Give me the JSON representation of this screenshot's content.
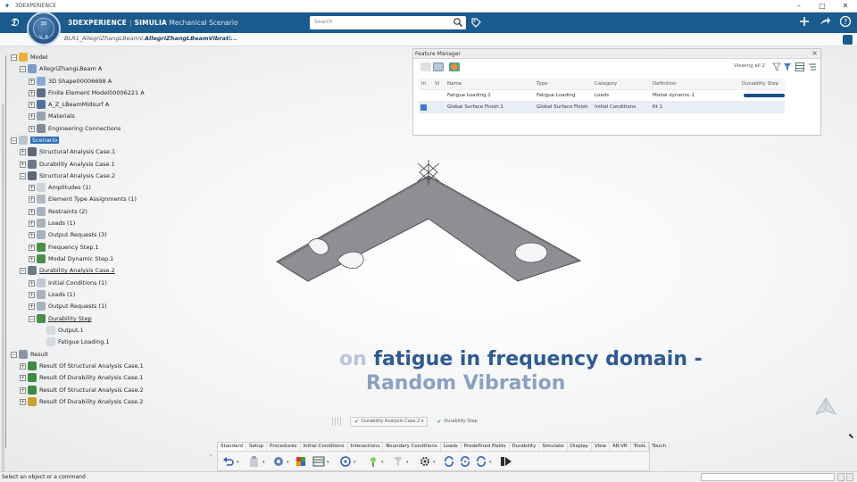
{
  "os_title": "3DEXPERIENCE",
  "window_controls": [
    "–",
    "□",
    "✕"
  ],
  "app": {
    "brand_3d": "3DEXPERIENCE",
    "sep": "|",
    "brand_simulia": "SIMULIA",
    "app_name": "Mechanical Scenario",
    "search_placeholder": "Search",
    "compass_top": "3D",
    "compass_bottom": "V, R"
  },
  "tabs": [
    {
      "label": "BLR1_AllegriZhangLBeamV..."
    },
    {
      "label": "AllegriZhangLBeamVibrati..."
    },
    {
      "label": "+"
    }
  ],
  "tree": {
    "nodes": [
      {
        "label": "Model"
      },
      {
        "label": "AllegriZhangLBeam A"
      },
      {
        "label": "3D Shape00006698 A"
      },
      {
        "label": "Finite Element Model00006221 A"
      },
      {
        "label": "A_Z_LBeamMidsurf A"
      },
      {
        "label": "Materials"
      },
      {
        "label": "Engineering Connections"
      },
      {
        "label": "Scenario"
      },
      {
        "label": "Structural Analysis Case.1"
      },
      {
        "label": "Durability Analysis Case.1"
      },
      {
        "label": "Structural Analysis Case.2"
      },
      {
        "label": "Amplitudes (1)"
      },
      {
        "label": "Element Type Assignments (1)"
      },
      {
        "label": "Restraints (2)"
      },
      {
        "label": "Loads (1)"
      },
      {
        "label": "Output Requests (3)"
      },
      {
        "label": "Frequency Step.1"
      },
      {
        "label": "Modal Dynamic Step.1"
      },
      {
        "label": "Durability Analysis Case.2"
      },
      {
        "label": "Initial Conditions (1)"
      },
      {
        "label": "Loads (1)"
      },
      {
        "label": "Output Requests (1)"
      },
      {
        "label": "Durability Step"
      },
      {
        "label": "Output.1"
      },
      {
        "label": "Fatigue Loading.1"
      },
      {
        "label": "Result"
      },
      {
        "label": "Result Of Structural Analysis Case.1"
      },
      {
        "label": "Result Of Durability Analysis Case.1"
      },
      {
        "label": "Result Of Structural Analysis Case.2"
      },
      {
        "label": "Result Of Durability Analysis Case.2"
      }
    ]
  },
  "feature_manager": {
    "title": "Feature Manager",
    "viewing": "Viewing all 2",
    "columns": [
      "In",
      "Vi",
      "Name",
      "Type",
      "Category",
      "Definition",
      "Durability Step"
    ],
    "rows": [
      {
        "name": "Fatigue Loading.1",
        "type": "Fatigue Loading",
        "category": "Loads",
        "definition": "Modal dynamic.1",
        "checked": false
      },
      {
        "name": "Global Surface Finish.1",
        "type": "Global Surface Finish",
        "category": "Initial Conditions",
        "definition": "Kt 1",
        "checked": true
      }
    ]
  },
  "subtitle": {
    "line1_faded": "on",
    "line1": " fatigue in frequency domain -",
    "line2": "Random Vibration"
  },
  "breadcrumb": {
    "case": "Durability Analysis Case.2",
    "step": "Durability Step"
  },
  "action_bar": {
    "tabs": [
      "Standard",
      "Setup",
      "Procedures",
      "Initial Conditions",
      "Interactions",
      "Boundary Conditions",
      "Loads",
      "Predefined Fields",
      "Durability",
      "Simulate",
      "Display",
      "View",
      "AR-VR",
      "Tools",
      "Touch"
    ],
    "active_tab": "Standard"
  },
  "status": {
    "text": "Select an object or a command"
  },
  "colors": {
    "topbar": "#1a5a8c",
    "subtitle": "#2f5a92",
    "selection": "#2f6db5",
    "progress": "#1c4f86"
  }
}
